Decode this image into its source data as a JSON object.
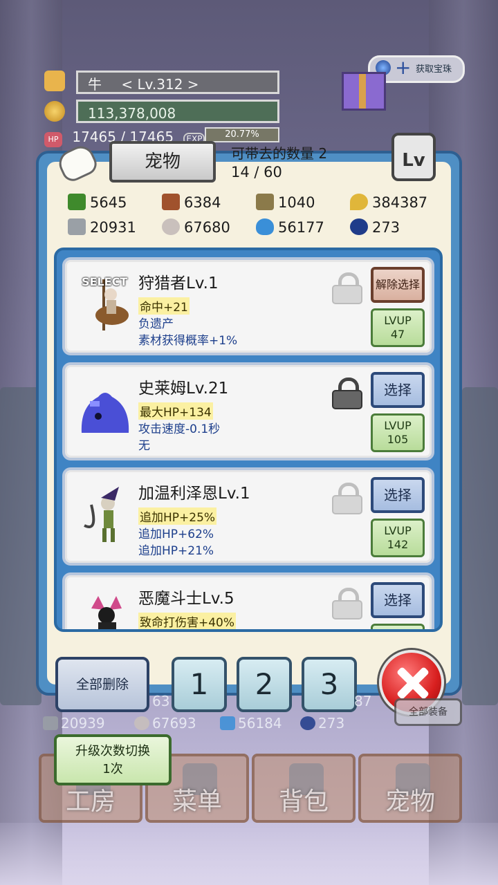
{
  "hud": {
    "player_name": "牛",
    "player_level": "< Lv.312 >",
    "gold": "113,378,008",
    "hp_label": "HP",
    "hp_value": "17465 / 17465",
    "exp_label": "EXP",
    "exp_percent": "20.77%",
    "obtain_gems_label": "获取宝珠"
  },
  "dialog": {
    "title": "宠物",
    "carry_label": "可带去的数量 2",
    "pet_count": "14 / 60",
    "lv_label": "Lv"
  },
  "resources": [
    {
      "icon": "herb-icon",
      "value": "5645",
      "color": "#3f8a2c"
    },
    {
      "icon": "log-icon",
      "value": "6384",
      "color": "#a0522d"
    },
    {
      "icon": "plank-icon",
      "value": "1040",
      "color": "#8b7a4a"
    },
    {
      "icon": "oil-drop-icon",
      "value": "384387",
      "color": "#e0b63a"
    },
    {
      "icon": "ingot-icon",
      "value": "20931",
      "color": "#9aa0a6"
    },
    {
      "icon": "ore-icon",
      "value": "67680",
      "color": "#c9c0bc"
    },
    {
      "icon": "blue-flame-icon",
      "value": "56177",
      "color": "#3a8fd8"
    },
    {
      "icon": "orb-icon",
      "value": "273",
      "color": "#1f3c8a"
    }
  ],
  "pets": [
    {
      "name": "狩猎者Lv.1",
      "select_tag": "SELECT",
      "stats": [
        "命中+21",
        "负遗产",
        "素材获得概率+1%"
      ],
      "locked": false,
      "action": "解除选择",
      "lvup_label": "LVUP",
      "lvup_cost": "47",
      "lvup_icon": "ore-icon"
    },
    {
      "name": "史莱姆Lv.21",
      "stats": [
        "最大HP+134",
        "攻击速度-0.1秒",
        "无"
      ],
      "locked": true,
      "action": "选择",
      "lvup_label": "LVUP",
      "lvup_cost": "105",
      "lvup_icon": "plank-icon"
    },
    {
      "name": "加温利泽恩Lv.1",
      "stats": [
        "追加HP+25%",
        "追加HP+62%",
        "追加HP+21%"
      ],
      "locked": false,
      "action": "选择",
      "lvup_label": "LVUP",
      "lvup_cost": "142",
      "lvup_icon": "blue-flame-icon"
    },
    {
      "name": "恶魔斗士Lv.5",
      "stats": [
        "致命打伤害+40%"
      ],
      "locked": false,
      "action": "选择"
    }
  ],
  "buttons": {
    "delete_all": "全部删除",
    "preset_1": "1",
    "preset_2": "2",
    "preset_3": "3",
    "equip_all": "全部装备",
    "upgrade_toggle_line1": "升级次数切换",
    "upgrade_toggle_line2": "1次"
  },
  "background_resources": {
    "partial_top_left": "63",
    "partial_top_right": "87",
    "ingot": "20939",
    "ore": "67693",
    "flame": "56184",
    "orb": "273"
  },
  "nav": [
    {
      "label": "工房",
      "icon": "workshop-icon"
    },
    {
      "label": "菜单",
      "icon": "book-icon"
    },
    {
      "label": "背包",
      "icon": "backpack-icon"
    },
    {
      "label": "宠物",
      "icon": "dragon-icon"
    }
  ]
}
